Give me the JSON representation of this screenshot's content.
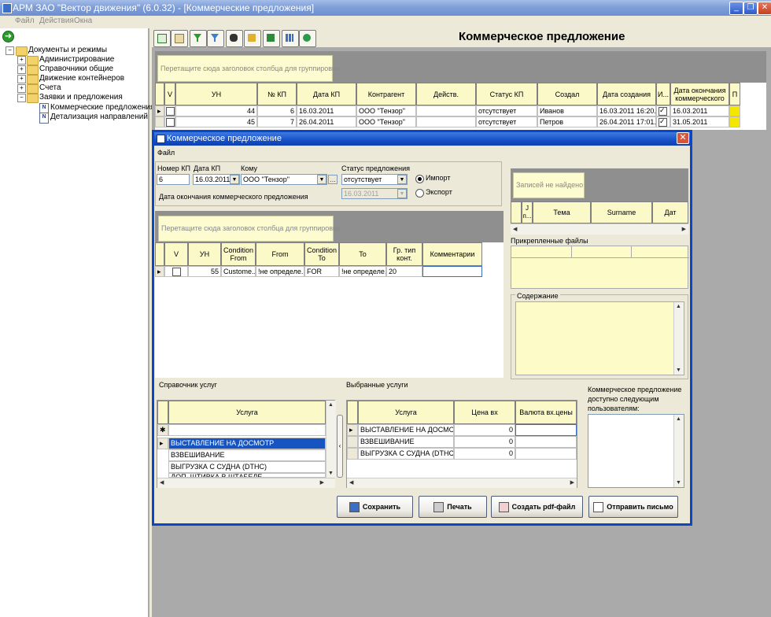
{
  "window": {
    "title": "АРМ ЗАО \"Вектор движения\" (6.0.32) - [Коммерческие предложения]",
    "menu": [
      "Файл",
      "Действия",
      "Окна"
    ]
  },
  "tree": {
    "root": "Документы и режимы",
    "items": [
      "Администрирование",
      "Справочники общие",
      "Движение контейнеров",
      "Счета",
      "Заявки и предложения"
    ],
    "subitems": [
      "Коммерческие предложения",
      "Детализация направлений"
    ]
  },
  "main": {
    "title": "Коммерческое предложение",
    "group_hint": "Перетащите сюда заголовок столбца для группировки",
    "columns": [
      "V",
      "УН",
      "№ КП",
      "Дата КП",
      "Контрагент",
      "Действ.",
      "Статус КП",
      "Создал",
      "Дата создания",
      "И...",
      "Дата окончания коммерческого",
      "П"
    ],
    "rows": [
      {
        "un": "44",
        "kp": "6",
        "date": "16.03.2011",
        "agent": "ООО \"Тензор\"",
        "action": "",
        "status": "отсутствует",
        "creator": "Иванов",
        "created": "16.03.2011 16:20...",
        "end": "16.03.2011"
      },
      {
        "un": "45",
        "kp": "7",
        "date": "26.04.2011",
        "agent": "ООО \"Тензор\"",
        "action": "",
        "status": "отсутствует",
        "creator": "Петров",
        "created": "26.04.2011 17:01...",
        "end": "31.05.2011"
      }
    ]
  },
  "dialog": {
    "title": "Коммерческое предложение",
    "menu": "Файл",
    "labels": {
      "kp_no": "Номер КП",
      "kp_date": "Дата КП",
      "to": "Кому",
      "status": "Статус предложения",
      "end_date": "Дата окончания коммерческого предложения",
      "import": "Импорт",
      "export": "Экспорт"
    },
    "values": {
      "kp_no": "6",
      "kp_date": "16.03.2011",
      "to": "ООО \"Тензор\"",
      "status": "отсутствует",
      "end_date": "16.03.2011"
    },
    "group_hint": "Перетащите сюда заголовок столбца для группировки",
    "route_columns": [
      "V",
      "УН",
      "Condition From",
      "From",
      "Condition To",
      "To",
      "Гр. тип конт.",
      "Комментарии"
    ],
    "route_row": {
      "un": "55",
      "cfrom": "Custome...",
      "from": "!не определе...",
      "cto": "FOR",
      "to": "!не определе...",
      "gr": "20",
      "comment": ""
    },
    "right_panel": {
      "no_records": "Записей не найдено",
      "columns": [
        "Ј п...",
        "Тема",
        "Surname",
        "Дат"
      ],
      "attached": "Прикрепленные файлы",
      "content": "Содержание"
    },
    "services": {
      "label": "Справочник услуг",
      "column": "Услуга",
      "items": [
        "ВЫСТАВЛЕНИЕ НА ДОСМОТР",
        "ВЗВЕШИВАНИЕ",
        "ВЫГРУЗКА С СУДНА (DTHC)",
        "ДОП. ШТИВКА В ШТАБЕЛЕ"
      ]
    },
    "selected": {
      "label": "Выбранные услуги",
      "columns": [
        "Услуга",
        "Цена вх",
        "Валюта вх.цены"
      ],
      "rows": [
        {
          "name": "ВЫСТАВЛЕНИЕ НА ДОСМО...",
          "price": "0",
          "cur": ""
        },
        {
          "name": "ВЗВЕШИВАНИЕ",
          "price": "0",
          "cur": ""
        },
        {
          "name": "ВЫГРУЗКА С СУДНА (DTHC)",
          "price": "0",
          "cur": ""
        }
      ]
    },
    "users_label": "Коммерческое предложение доступно следующим пользователям:",
    "buttons": {
      "save": "Сохранить",
      "print": "Печать",
      "pdf": "Создать pdf-файл",
      "mail": "Отправить письмо"
    }
  }
}
